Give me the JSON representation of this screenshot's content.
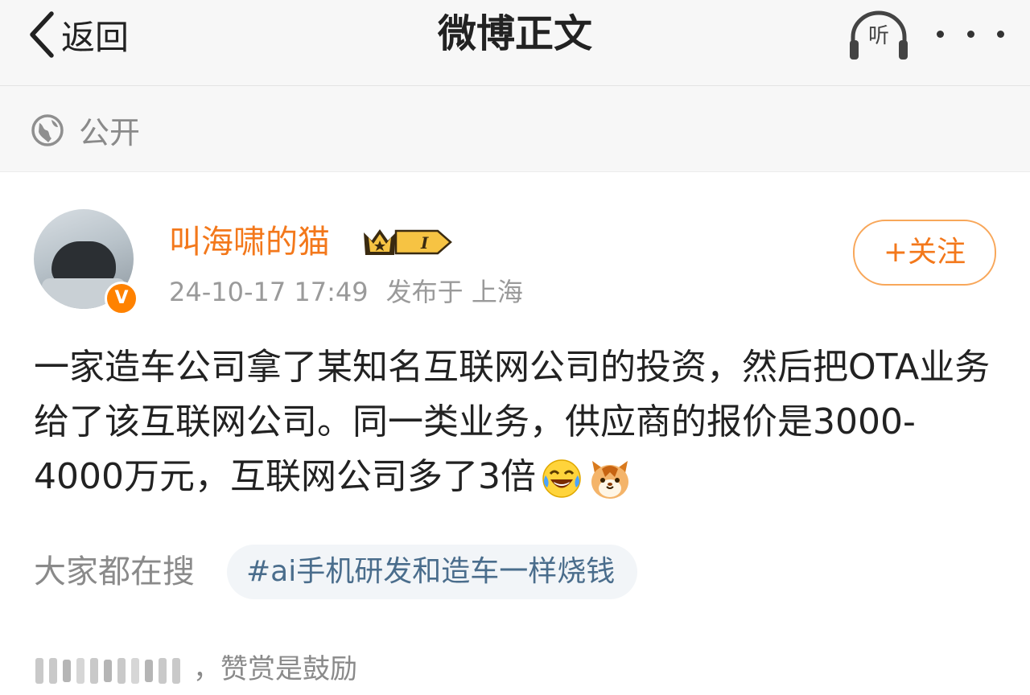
{
  "header": {
    "back_label": "返回",
    "title": "微博正文",
    "listen_label": "听",
    "more_icon": "more-dots-icon"
  },
  "visibility": {
    "icon": "globe-icon",
    "label": "公开"
  },
  "post": {
    "author": {
      "name": "叫海啸的猫",
      "verified_icon": "verified-v-icon",
      "badge_icon": "vip-crown-badge-icon",
      "badge_level": "I"
    },
    "follow_label": "+关注",
    "timestamp": "24-10-17 17:49",
    "location": "发布于 上海",
    "content_text": "一家造车公司拿了某知名互联网公司的投资，然后把OTA业务给了该互联网公司。同一类业务，供应商的报价是3000-4000万元，互联网公司多了3倍",
    "emojis": [
      "laugh-cry-emoji-icon",
      "cat-face-emoji-icon"
    ]
  },
  "trending": {
    "label": "大家都在搜",
    "tag": "#ai手机研发和造车一样烧钱"
  },
  "reward": {
    "text": "，赞赏是鼓励"
  },
  "colors": {
    "accent_orange": "#f3781b",
    "tag_text": "#4a6d8c",
    "tag_bg": "#f2f5f8",
    "muted_text": "#8a8a8a",
    "header_bg": "#f7f7f7"
  }
}
